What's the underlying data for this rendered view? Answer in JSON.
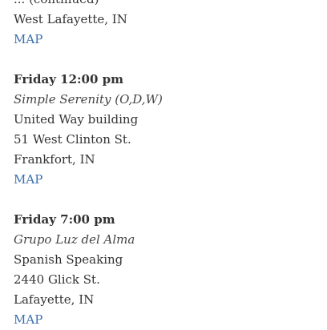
{
  "top_partial": {
    "cut_text": "... (continued)",
    "city": "West Lafayette, IN",
    "map_label": "MAP"
  },
  "meetings": [
    {
      "when": "Friday 12:00 pm",
      "group": "Simple Serenity (O,D,W)",
      "lines": [
        "United Way building",
        "51 West Clinton St.",
        "Frankfort, IN"
      ],
      "map_label": "MAP"
    },
    {
      "when": "Friday 7:00 pm",
      "group": "Grupo Luz del Alma",
      "lines": [
        "Spanish Speaking",
        "2440 Glick St.",
        "Lafayette, IN"
      ],
      "map_label": "MAP"
    }
  ],
  "colors": {
    "link": "#3a6fb0",
    "text": "#333333"
  }
}
